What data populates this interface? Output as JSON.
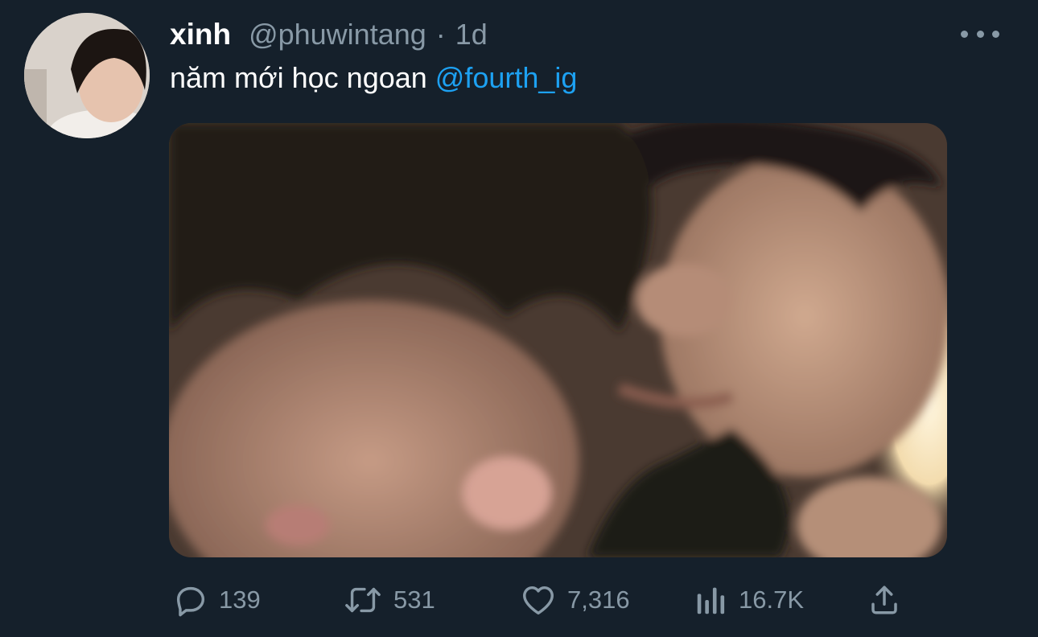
{
  "tweet": {
    "display_name": "xinh",
    "handle": "@phuwintang",
    "separator": "·",
    "timestamp": "1d",
    "text": "năm mới học ngoan",
    "mention": "@fourth_ig",
    "avatar_icon": "profile-photo",
    "more_icon": "more-dots-icon"
  },
  "actions": {
    "reply_count": "139",
    "retweet_count": "531",
    "like_count": "7,316",
    "views_count": "16.7K"
  },
  "colors": {
    "background": "#15202b",
    "secondary_text": "#8899a6",
    "link": "#1da1f2"
  }
}
